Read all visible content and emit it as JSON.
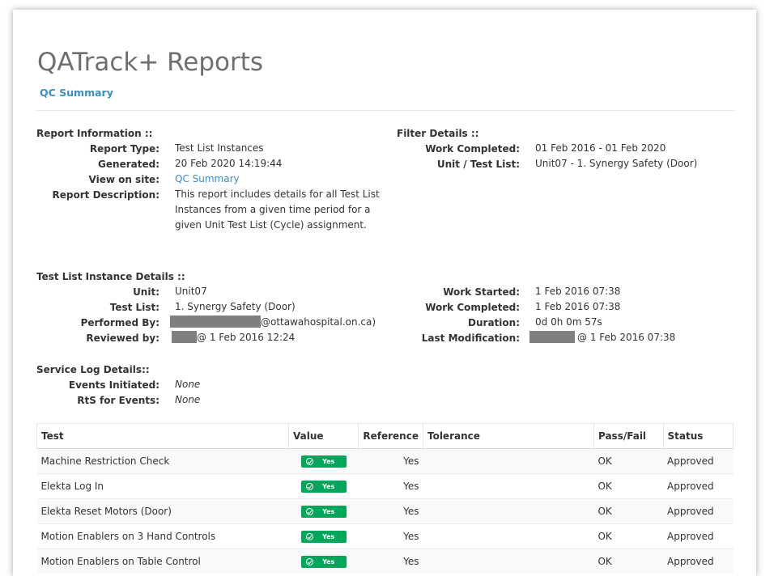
{
  "header": {
    "title": "QATrack+ Reports",
    "subtitle": "QC Summary"
  },
  "report_info": {
    "section_title": "Report Information ::",
    "rows": [
      {
        "label": "Report Type:",
        "value": "Test List Instances"
      },
      {
        "label": "Generated:",
        "value": "20 Feb 2020 14:19:44"
      },
      {
        "label": "View on site:",
        "value": "QC Summary"
      },
      {
        "label": "Report Description:",
        "lines": [
          "This report includes details for all Test List",
          "Instances from a given time period for a",
          "given Unit Test List (Cycle) assignment."
        ]
      }
    ]
  },
  "filter_details": {
    "section_title": "Filter Details ::",
    "rows": [
      {
        "label": "Work Completed:",
        "value": "01 Feb 2016 - 01 Feb 2020"
      },
      {
        "label": "Unit / Test List:",
        "value": "Unit07 - 1. Synergy Safety (Door)"
      }
    ]
  },
  "instance_details": {
    "section_title": "Test List Instance Details ::",
    "left": [
      {
        "label": "Unit:",
        "value": "Unit07"
      },
      {
        "label": "Test List:",
        "value": "1. Synergy Safety (Door)"
      },
      {
        "label": "Performed By:",
        "value": "@ottawahospital.on.ca)"
      },
      {
        "label": "Reviewed by:",
        "value": "@ 1 Feb 2016 12:24"
      }
    ],
    "right": [
      {
        "label": "Work Started:",
        "value": "1 Feb 2016 07:38"
      },
      {
        "label": "Work Completed:",
        "value": "1 Feb 2016 07:38"
      },
      {
        "label": "Duration:",
        "value": "0d 0h 0m 57s"
      },
      {
        "label": "Last Modification:",
        "value": "@ 1 Feb 2016 07:38"
      }
    ]
  },
  "service_log": {
    "section_title": "Service Log Details::",
    "rows": [
      {
        "label": "Events Initiated:",
        "value": "None"
      },
      {
        "label": "RtS for Events:",
        "value": "None"
      }
    ]
  },
  "table": {
    "headers": [
      "Test",
      "Value",
      "Reference",
      "Tolerance",
      "Pass/Fail",
      "Status"
    ],
    "rows": [
      {
        "test": "Machine Restriction Check",
        "value": "Yes",
        "reference": "Yes",
        "tolerance": "",
        "pass_fail": "OK",
        "status": "Approved"
      },
      {
        "test": "Elekta Log In",
        "value": "Yes",
        "reference": "Yes",
        "tolerance": "",
        "pass_fail": "OK",
        "status": "Approved"
      },
      {
        "test": "Elekta Reset Motors (Door)",
        "value": "Yes",
        "reference": "Yes",
        "tolerance": "",
        "pass_fail": "OK",
        "status": "Approved"
      },
      {
        "test": "Motion Enablers on 3 Hand Controls",
        "value": "Yes",
        "reference": "Yes",
        "tolerance": "",
        "pass_fail": "OK",
        "status": "Approved"
      },
      {
        "test": "Motion Enablers on Table Control",
        "value": "Yes",
        "reference": "Yes",
        "tolerance": "",
        "pass_fail": "OK",
        "status": "Approved"
      }
    ]
  },
  "colors": {
    "link": "#3c8dbc",
    "badge_ok": "#00a65a",
    "redaction": "#7f7f7f",
    "title": "#6f6f6f"
  }
}
